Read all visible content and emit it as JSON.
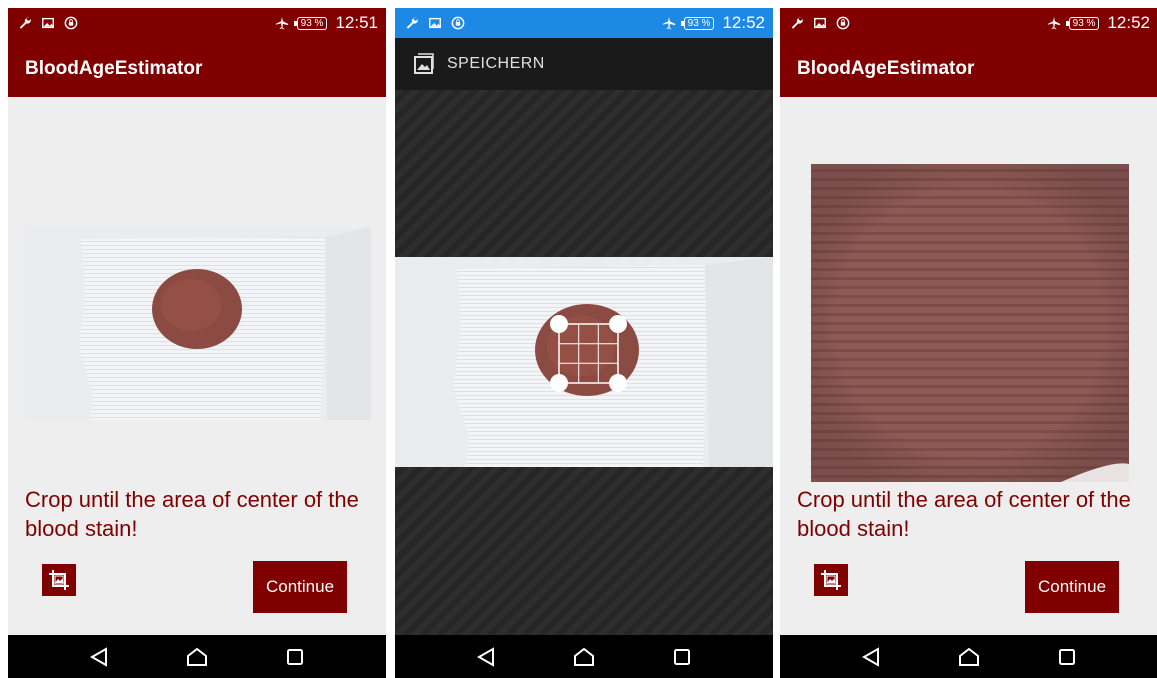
{
  "screens": [
    {
      "status": {
        "battery": "93 %",
        "time": "12:51"
      },
      "app_title": "BloodAgeEstimator",
      "prompt": "Crop until the area of center of the blood stain!",
      "continue_label": "Continue"
    },
    {
      "status": {
        "battery": "93 %",
        "time": "12:52"
      },
      "save_label": "SPEICHERN"
    },
    {
      "status": {
        "battery": "93 %",
        "time": "12:52"
      },
      "app_title": "BloodAgeEstimator",
      "prompt": "Crop until the area of center of the blood stain!",
      "continue_label": "Continue"
    }
  ],
  "colors": {
    "accent": "#800000",
    "status_blue": "#1e88e5",
    "background": "#eeeeee",
    "nav": "#000000"
  },
  "icons": [
    "wrench-icon",
    "image-icon",
    "vpn-lock-icon",
    "airplane-icon",
    "battery-icon",
    "crop-icon",
    "gallery-icon",
    "back-icon",
    "home-icon",
    "recents-icon"
  ]
}
